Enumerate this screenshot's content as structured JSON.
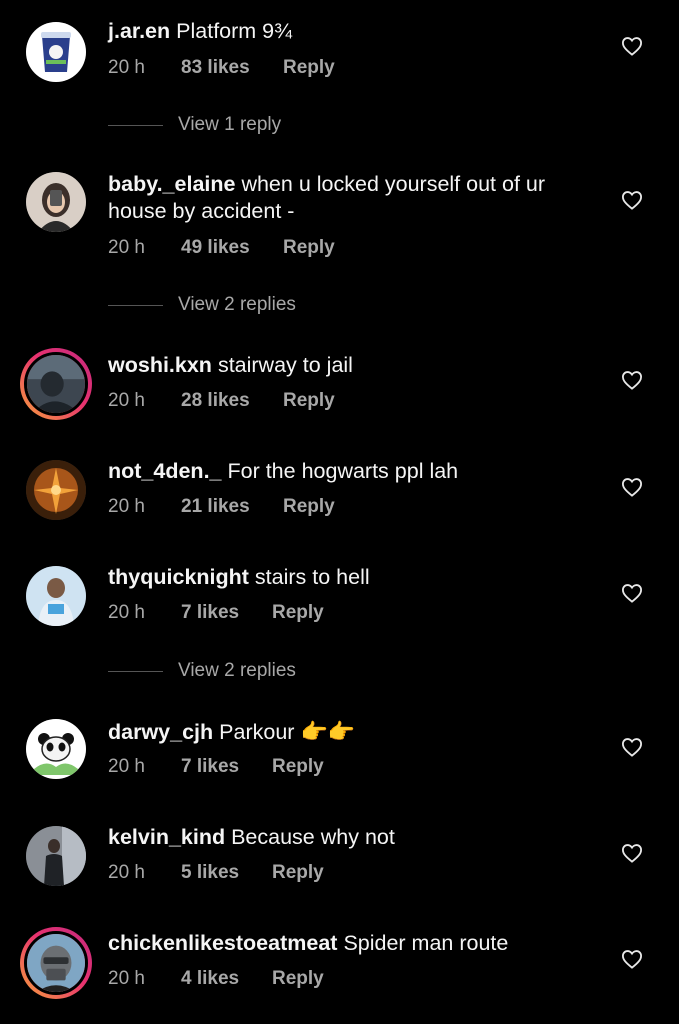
{
  "comments": [
    {
      "user": "j.ar.en",
      "text": "Platform 9¾",
      "time": "20 h",
      "likes": "83 likes",
      "reply": "Reply",
      "avatar": "ice-cream-tub-avatar"
    },
    {
      "user": "baby._elaine",
      "text": "when u locked yourself out of ur house by accident -",
      "time": "20 h",
      "likes": "49 likes",
      "reply": "Reply",
      "avatar": "selfie-avatar"
    },
    {
      "user": "woshi.kxn",
      "text": "stairway to jail",
      "time": "20 h",
      "likes": "28 likes",
      "reply": "Reply",
      "avatar": "story-ring-avatar"
    },
    {
      "user": "not_4den._",
      "text": "For the hogwarts ppl lah",
      "time": "20 h",
      "likes": "21 likes",
      "reply": "Reply",
      "avatar": "fire-art-avatar"
    },
    {
      "user": "thyquicknight",
      "text": "stairs to hell",
      "time": "20 h",
      "likes": "7 likes",
      "reply": "Reply",
      "avatar": "person-avatar"
    },
    {
      "user": "darwy_cjh",
      "text": "Parkour",
      "emoji": "👉👉",
      "time": "20 h",
      "likes": "7 likes",
      "reply": "Reply",
      "avatar": "panda-avatar"
    },
    {
      "user": "kelvin_kind",
      "text": "Because why not",
      "time": "20 h",
      "likes": "5 likes",
      "reply": "Reply",
      "avatar": "mirror-selfie-avatar"
    },
    {
      "user": "chickenlikestoeatmeat",
      "text": "Spider man route",
      "time": "20 h",
      "likes": "4 likes",
      "reply": "Reply",
      "avatar": "masked-face-avatar"
    }
  ],
  "view_replies": [
    {
      "label": "View 1 reply"
    },
    {
      "label": "View 2 replies"
    },
    {
      "label": "View 2 replies"
    }
  ],
  "colors": {
    "background": "#000000",
    "text": "#f5f5f5",
    "secondary": "#a8a8a8",
    "story_ring_start": "#f8a33c",
    "story_ring_end": "#c2297f"
  }
}
